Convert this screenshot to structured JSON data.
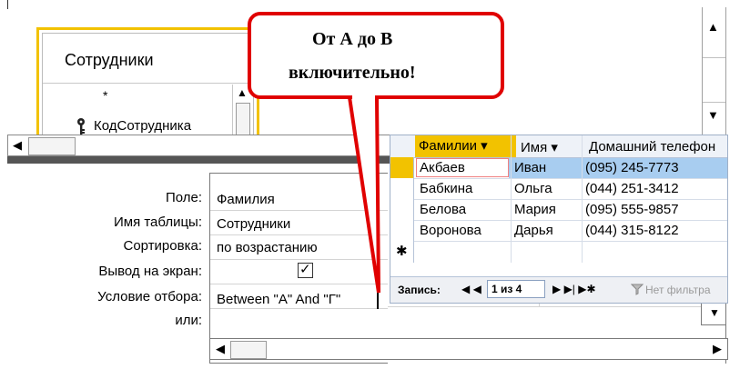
{
  "design_table": {
    "title": "Сотрудники",
    "fields": [
      "*",
      "КодСотрудника"
    ]
  },
  "callout": {
    "line1": "От А до В",
    "line2": "включительно!"
  },
  "qbe_grid": {
    "labels": {
      "field": "Поле:",
      "table": "Имя таблицы:",
      "sort": "Сортировка:",
      "show": "Вывод на экран:",
      "criteria": "Условие отбора:",
      "or": "или:"
    },
    "values": {
      "field": "Фамилия",
      "table": "Сотрудники",
      "sort": "по возрастанию",
      "show_checked": true,
      "show_mark": "✓",
      "criteria": "Between \"A\" And \"Г\""
    }
  },
  "datasheet": {
    "columns": [
      "Фамилии ▾",
      "Имя ▾",
      "Домашний телефон"
    ],
    "rows": [
      [
        "Акбаев",
        "Иван",
        "(095) 245-7773"
      ],
      [
        "Бабкина",
        "Ольга",
        "(044) 251-3412"
      ],
      [
        "Белова",
        "Мария",
        "(095) 555-9857"
      ],
      [
        "Воронова",
        "Дарья",
        "(044) 315-8122"
      ]
    ],
    "new_row_marker": "✱",
    "nav": {
      "record_label": "Запись:",
      "first_prev": "◀ ◀",
      "position": "1 из 4",
      "next_last_new": "▶ ▶| ▶✱",
      "filter_label": "Нет фильтра"
    }
  },
  "icons": {
    "key": "key-icon",
    "funnel": "funnel-icon"
  },
  "colors": {
    "selection_yellow": "#f2c200",
    "callout_red": "#e00000",
    "row_highlight": "#a8cdf0"
  }
}
